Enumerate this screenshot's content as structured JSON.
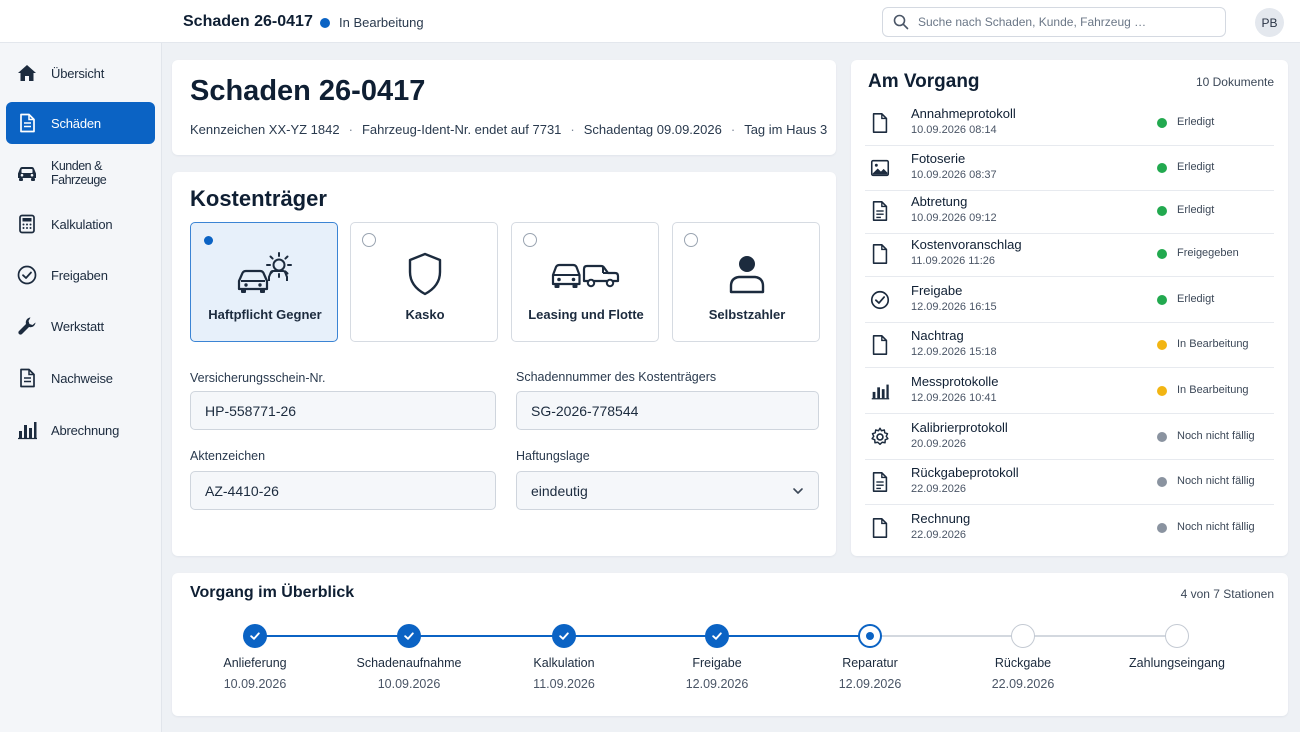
{
  "topbar": {
    "title": "Schaden 26-0417",
    "status": "In Bearbeitung",
    "search_placeholder": "Suche nach Schaden, Kunde, Fahrzeug …",
    "avatar_initials": "PB"
  },
  "sidebar": {
    "items": [
      {
        "label": "Übersicht",
        "icon": "home-icon",
        "active": false
      },
      {
        "label": "Schäden",
        "icon": "document-icon",
        "active": true
      },
      {
        "label": "Kunden & Fahrzeuge",
        "icon": "car-icon",
        "active": false
      },
      {
        "label": "Kalkulation",
        "icon": "calculator-icon",
        "active": false
      },
      {
        "label": "Freigaben",
        "icon": "check-circle-icon",
        "active": false
      },
      {
        "label": "Werkstatt",
        "icon": "wrench-icon",
        "active": false
      },
      {
        "label": "Nachweise",
        "icon": "document-icon",
        "active": false
      },
      {
        "label": "Abrechnung",
        "icon": "bar-chart-icon",
        "active": false
      }
    ]
  },
  "claim": {
    "title": "Schaden 26-0417",
    "meta": [
      "Kennzeichen XX-YZ 1842",
      "Fahrzeug-Ident-Nr. endet auf 7731",
      "Schadentag 09.09.2026",
      "Tag im Haus 3"
    ]
  },
  "payer": {
    "title": "Kostenträger",
    "options": [
      {
        "label": "Haftpflicht Gegner",
        "icon": "car-collision-icon",
        "selected": true
      },
      {
        "label": "Kasko",
        "icon": "shield-icon",
        "selected": false
      },
      {
        "label": "Leasing und Flotte",
        "icon": "fleet-icon",
        "selected": false
      },
      {
        "label": "Selbstzahler",
        "icon": "person-icon",
        "selected": false
      }
    ],
    "fields": {
      "policy_label": "Versicherungsschein-Nr.",
      "policy_value": "HP-558771-26",
      "claim_no_label": "Schadennummer des Kostenträgers",
      "claim_no_value": "SG-2026-778544",
      "file_label": "Aktenzeichen",
      "file_value": "AZ-4410-26",
      "liability_label": "Haftungslage",
      "liability_value": "eindeutig"
    }
  },
  "documents": {
    "title": "Am Vorgang",
    "count": "10 Dokumente",
    "items": [
      {
        "name": "Annahmeprotokoll",
        "date": "10.09.2026 08:14",
        "status": "Erledigt",
        "status_color": "#22a94f",
        "icon": "document-icon"
      },
      {
        "name": "Fotoserie",
        "date": "10.09.2026 08:37",
        "status": "Erledigt",
        "status_color": "#22a94f",
        "icon": "image-icon"
      },
      {
        "name": "Abtretung",
        "date": "10.09.2026 09:12",
        "status": "Erledigt",
        "status_color": "#22a94f",
        "icon": "document-lines-icon"
      },
      {
        "name": "Kostenvoranschlag",
        "date": "11.09.2026 11:26",
        "status": "Freigegeben",
        "status_color": "#22a94f",
        "icon": "document-icon"
      },
      {
        "name": "Freigabe",
        "date": "12.09.2026 16:15",
        "status": "Erledigt",
        "status_color": "#22a94f",
        "icon": "check-circle-icon"
      },
      {
        "name": "Nachtrag",
        "date": "12.09.2026 15:18",
        "status": "In Bearbeitung",
        "status_color": "#f2b513",
        "icon": "document-icon"
      },
      {
        "name": "Messprotokolle",
        "date": "12.09.2026 10:41",
        "status": "In Bearbeitung",
        "status_color": "#f2b513",
        "icon": "bar-chart-icon"
      },
      {
        "name": "Kalibrierprotokoll",
        "date": "20.09.2026",
        "status": "Noch nicht fällig",
        "status_color": "#8a93a0",
        "icon": "gear-icon"
      },
      {
        "name": "Rückgabeprotokoll",
        "date": "22.09.2026",
        "status": "Noch nicht fällig",
        "status_color": "#8a93a0",
        "icon": "document-lines-icon"
      },
      {
        "name": "Rechnung",
        "date": "22.09.2026",
        "status": "Noch nicht fällig",
        "status_color": "#8a93a0",
        "icon": "document-icon"
      }
    ]
  },
  "timeline": {
    "title": "Vorgang im Überblick",
    "count": "4 von 7 Stationen",
    "stations": [
      {
        "label": "Anlieferung",
        "date": "10.09.2026",
        "state": "done"
      },
      {
        "label": "Schadenaufnahme",
        "date": "10.09.2026",
        "state": "done"
      },
      {
        "label": "Kalkulation",
        "date": "11.09.2026",
        "state": "done"
      },
      {
        "label": "Freigabe",
        "date": "12.09.2026",
        "state": "done"
      },
      {
        "label": "Reparatur",
        "date": "12.09.2026",
        "state": "current"
      },
      {
        "label": "Rückgabe",
        "date": "22.09.2026",
        "state": "pending"
      },
      {
        "label": "Zahlungseingang",
        "date": "",
        "state": "pending"
      }
    ]
  },
  "colors": {
    "accent": "#0b63c4",
    "done": "#22a94f",
    "in_progress": "#f2b513",
    "pending": "#8a93a0"
  }
}
